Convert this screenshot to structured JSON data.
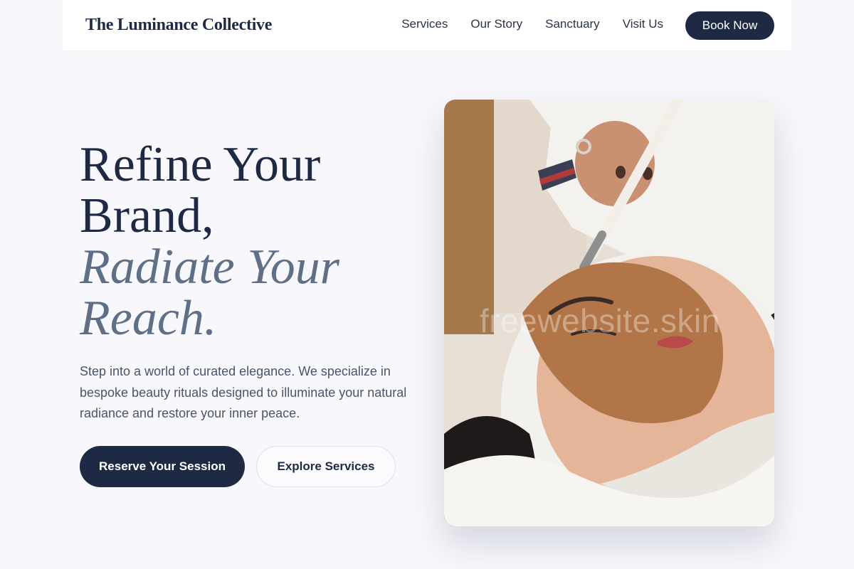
{
  "header": {
    "brand": "The Luminance Collective",
    "nav": [
      {
        "label": "Services"
      },
      {
        "label": "Our Story"
      },
      {
        "label": "Sanctuary"
      },
      {
        "label": "Visit Us"
      }
    ],
    "cta_label": "Book Now"
  },
  "hero": {
    "title_line1": "Refine Your",
    "title_line2": "Brand,",
    "title_line3": "Radiate Your",
    "title_line4": "Reach.",
    "description": "Step into a world of curated elegance. We specialize in bespoke beauty rituals designed to illuminate your natural radiance and restore your inner peace.",
    "primary_cta": "Reserve Your Session",
    "secondary_cta": "Explore Services",
    "image_watermark": "freewebsite.skin"
  },
  "colors": {
    "navy": "#1e2a44",
    "slate_accent": "#5f6f86",
    "page_bg": "#f7f7fc"
  }
}
